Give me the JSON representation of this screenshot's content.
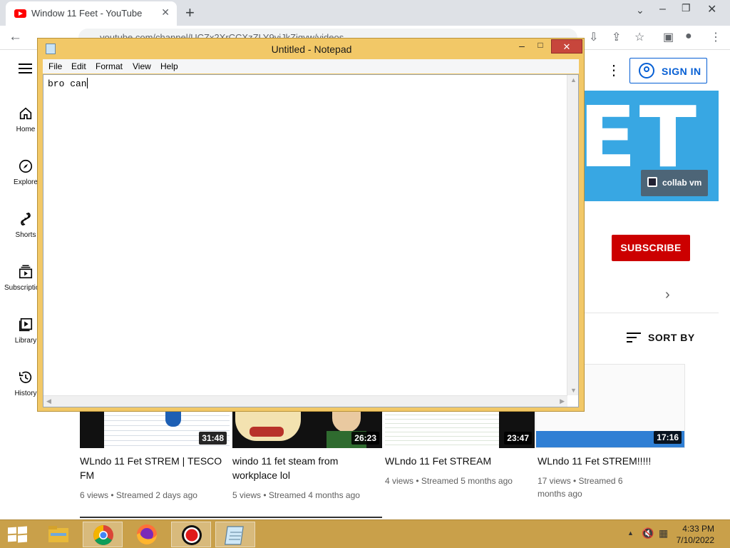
{
  "browser": {
    "tab_title": "Window 11 Feet - YouTube",
    "url": "youtube.com/channel/UCZx2XrCCXzZLY9vjJkZjqyw/videos"
  },
  "youtube": {
    "guide": [
      {
        "label": "Home",
        "icon": "home-icon"
      },
      {
        "label": "Explore",
        "icon": "compass-icon"
      },
      {
        "label": "Shorts",
        "icon": "shorts-icon"
      },
      {
        "label": "Subscriptions",
        "icon": "subscriptions-icon"
      },
      {
        "label": "Library",
        "icon": "library-icon"
      },
      {
        "label": "History",
        "icon": "history-icon"
      }
    ],
    "signin_label": "SIGN IN",
    "banner_text": "ET",
    "banner_badge": "collab vm",
    "subscribe_label": "SUBSCRIBE",
    "sort_label": "SORT BY",
    "videos": [
      {
        "title": "WLndo 11 Fet STREM | TESCO FM",
        "meta": "6 views • Streamed 2 days ago",
        "duration": "31:48"
      },
      {
        "title": "windo 11 fet steam from workplace lol",
        "meta": "5 views • Streamed 4 months ago",
        "duration": "26:23"
      },
      {
        "title": "WLndo 11 Fet STREAM",
        "meta": "4 views • Streamed 5 months ago",
        "duration": "23:47"
      },
      {
        "title": "WLndo 11 Fet STREM!!!!!",
        "meta": "17 views • Streamed 6 months ago",
        "duration": "17:16"
      }
    ]
  },
  "notepad": {
    "title": "Untitled - Notepad",
    "menu": [
      "File",
      "Edit",
      "Format",
      "View",
      "Help"
    ],
    "content": "bro can"
  },
  "taskbar": {
    "apps": [
      "file-explorer-icon",
      "chrome-icon",
      "firefox-icon",
      "recorder-icon",
      "notepad-icon"
    ],
    "time": "4:33 PM",
    "date": "7/10/2022"
  },
  "colors": {
    "accent_taskbar": "#c9a04a",
    "notepad_frame": "#f2c867",
    "youtube_red": "#cc0000",
    "banner_blue": "#38a7e3"
  }
}
